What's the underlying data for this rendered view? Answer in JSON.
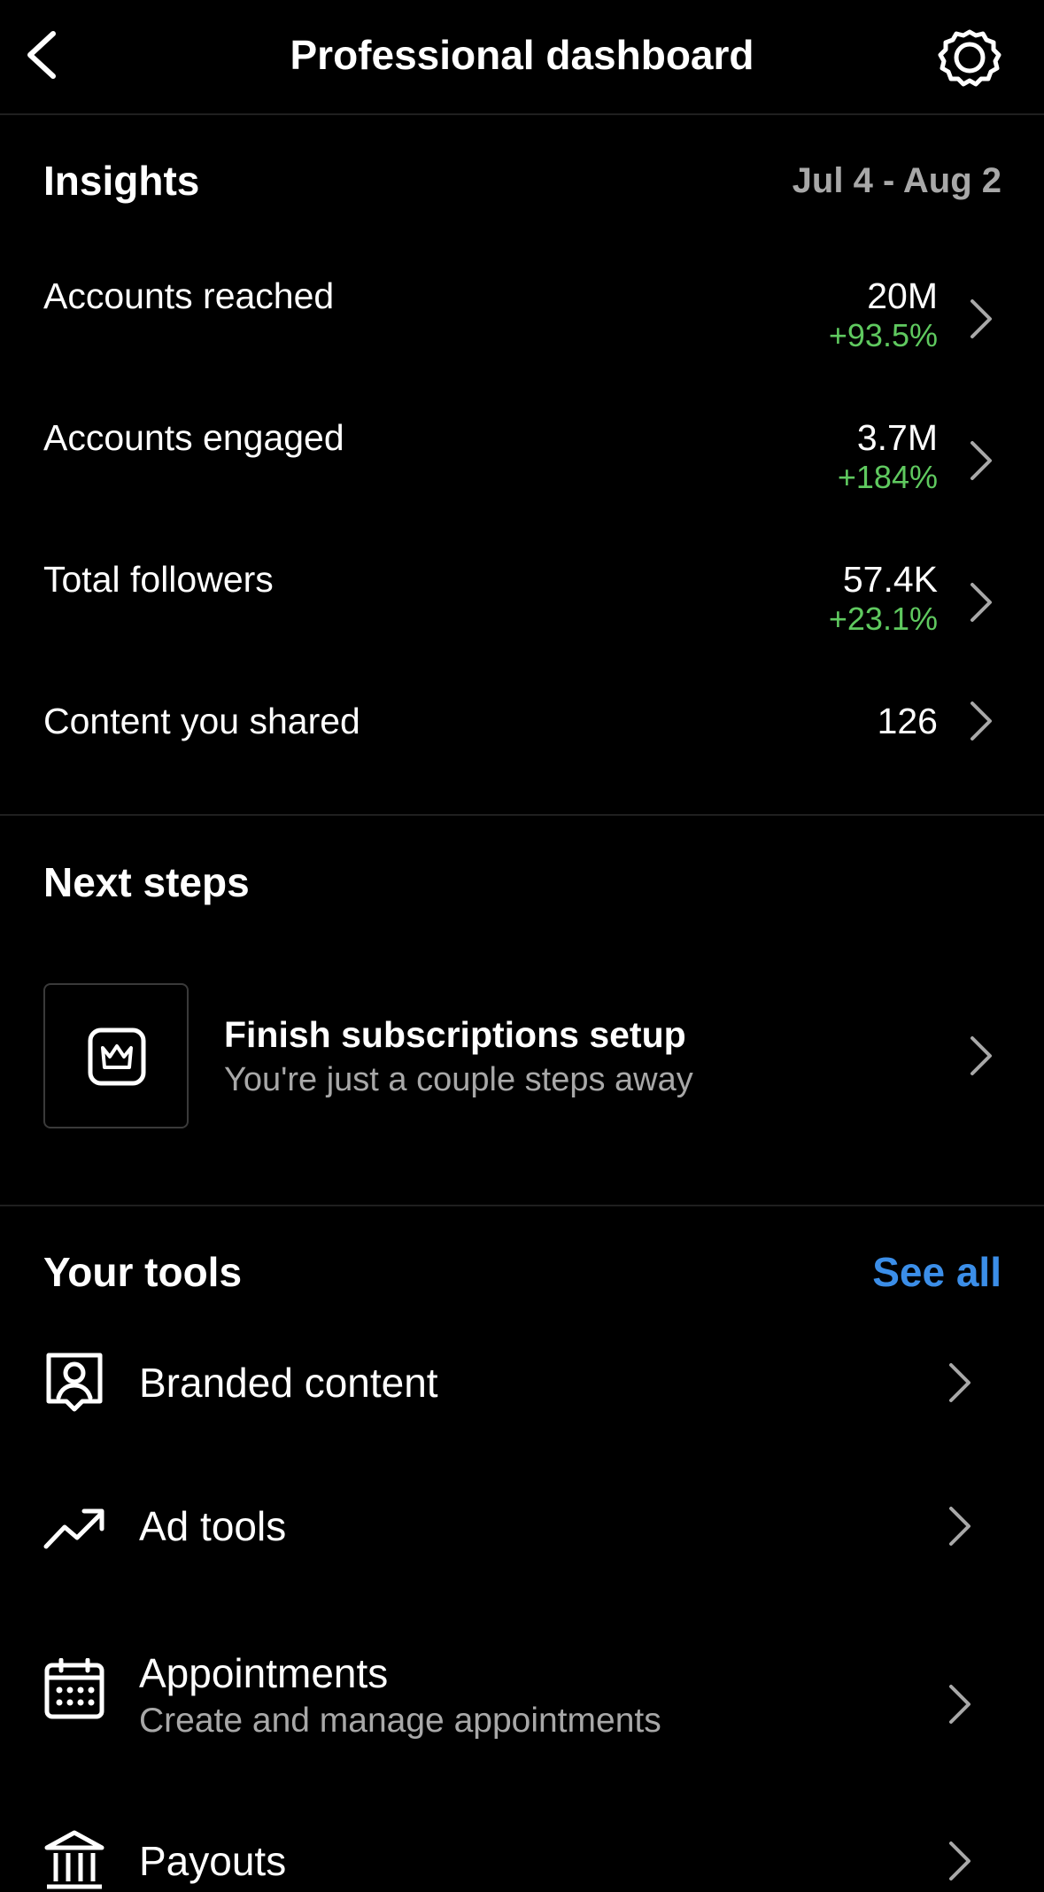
{
  "header": {
    "title": "Professional dashboard",
    "back_icon": "chevron-left-icon",
    "settings_icon": "gear-icon"
  },
  "insights": {
    "title": "Insights",
    "date_range": "Jul 4 - Aug 2",
    "metrics": [
      {
        "label": "Accounts reached",
        "value": "20M",
        "change": "+93.5%"
      },
      {
        "label": "Accounts engaged",
        "value": "3.7M",
        "change": "+184%"
      },
      {
        "label": "Total followers",
        "value": "57.4K",
        "change": "+23.1%"
      },
      {
        "label": "Content you shared",
        "value": "126",
        "change": ""
      }
    ]
  },
  "next_steps": {
    "title": "Next steps",
    "card": {
      "icon": "subscription-crown-icon",
      "title": "Finish subscriptions setup",
      "subtitle": "You're just a couple steps away"
    }
  },
  "tools": {
    "title": "Your tools",
    "see_all_label": "See all",
    "items": [
      {
        "label": "Branded content",
        "subtitle": "",
        "icon": "branded-content-icon"
      },
      {
        "label": "Ad tools",
        "subtitle": "",
        "icon": "trending-up-icon"
      },
      {
        "label": "Appointments",
        "subtitle": "Create and manage appointments",
        "icon": "calendar-icon"
      },
      {
        "label": "Payouts",
        "subtitle": "",
        "icon": "bank-icon"
      }
    ]
  },
  "colors": {
    "background": "#000000",
    "positive_change": "#5fc95f",
    "link": "#3b8ee8",
    "secondary_text": "#a8a8a8"
  }
}
